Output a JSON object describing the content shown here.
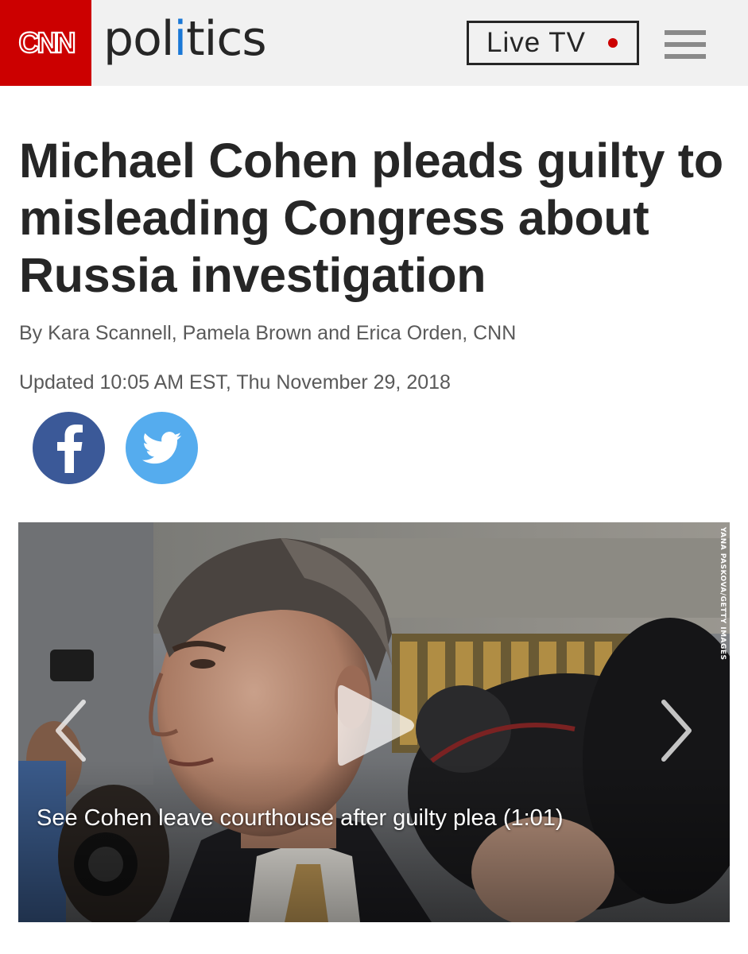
{
  "header": {
    "logo_text": "CNN",
    "section": {
      "prefix": "pol",
      "accent_letter": "i",
      "suffix": "tics"
    },
    "live_tv_label": "Live TV",
    "menu_icon": "hamburger-menu-icon"
  },
  "article": {
    "headline": "Michael Cohen pleads guilty to misleading Congress about Russia investigation",
    "byline": "By Kara Scannell, Pamela Brown and Erica Orden, CNN",
    "updated": "Updated 10:05 AM EST, Thu November 29, 2018"
  },
  "share": {
    "facebook_icon": "facebook-icon",
    "twitter_icon": "twitter-icon"
  },
  "video": {
    "caption": "See Cohen leave courthouse after guilty plea (1:01)",
    "photo_credit": "YANA PASKOVA/GETTY IMAGES",
    "icons": [
      "chevron-left-icon",
      "play-icon",
      "chevron-right-icon"
    ]
  },
  "colors": {
    "cnn_red": "#cc0000",
    "header_bg": "#f1f1f1",
    "text_dark": "#262626",
    "text_meta": "#595959",
    "accent_blue": "#1a78d6",
    "facebook": "#3b5998",
    "twitter": "#55acee",
    "live_dot": "#cc0000"
  }
}
